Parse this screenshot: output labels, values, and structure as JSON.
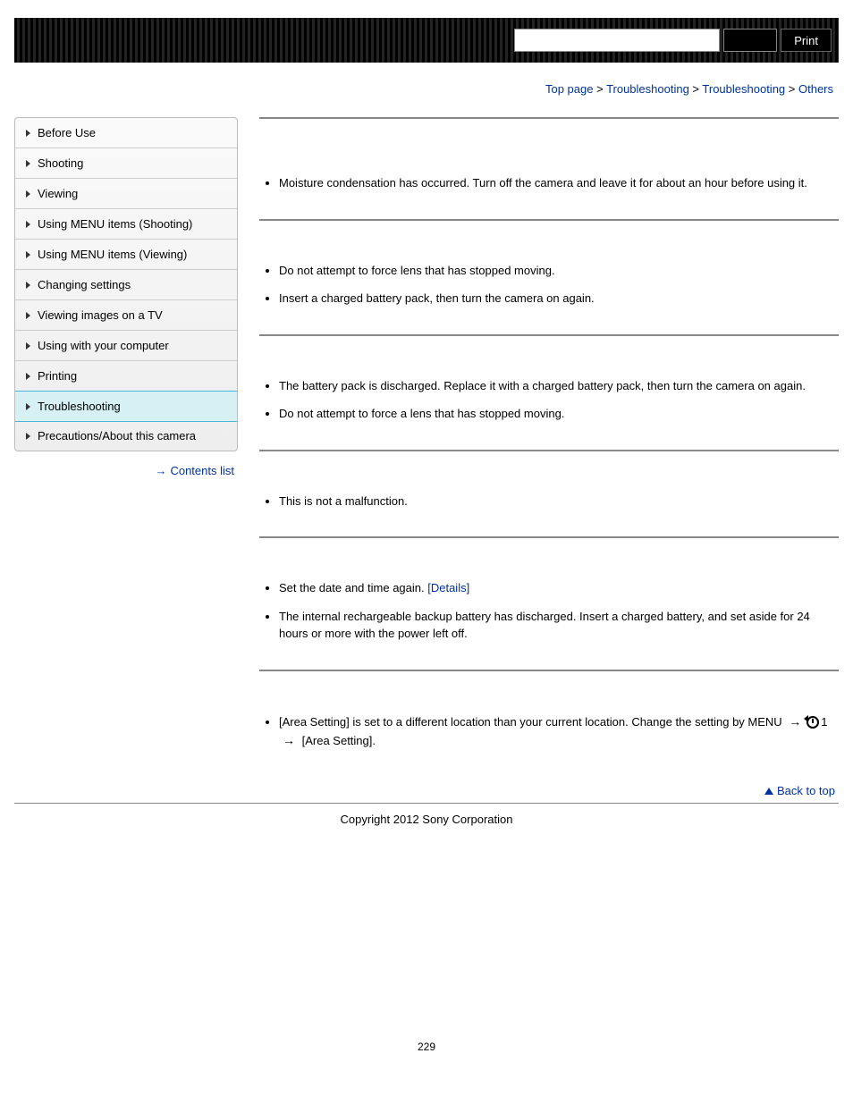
{
  "topbar": {
    "print": "Print"
  },
  "breadcrumb": {
    "items": [
      "Top page",
      "Troubleshooting",
      "Troubleshooting",
      "Others"
    ],
    "sep": " > "
  },
  "sidebar": {
    "items": [
      {
        "label": "Before Use"
      },
      {
        "label": "Shooting"
      },
      {
        "label": "Viewing"
      },
      {
        "label": "Using MENU items (Shooting)"
      },
      {
        "label": "Using MENU items (Viewing)"
      },
      {
        "label": "Changing settings"
      },
      {
        "label": "Viewing images on a TV"
      },
      {
        "label": "Using with your computer"
      },
      {
        "label": "Printing"
      },
      {
        "label": "Troubleshooting",
        "active": true
      },
      {
        "label": "Precautions/About this camera"
      }
    ],
    "contents_prefix": "→",
    "contents": "Contents list"
  },
  "sections": [
    {
      "items": [
        {
          "t": "Moisture condensation has occurred. Turn off the camera and leave it for about an hour before using it."
        }
      ]
    },
    {
      "items": [
        {
          "t": "Do not attempt to force lens that has stopped moving."
        },
        {
          "t": "Insert a charged battery pack, then turn the camera on again."
        }
      ]
    },
    {
      "items": [
        {
          "t": "The battery pack is discharged. Replace it with a charged battery pack, then turn the camera on again."
        },
        {
          "t": "Do not attempt to force a lens that has stopped moving."
        }
      ]
    },
    {
      "items": [
        {
          "t": "This is not a malfunction."
        }
      ]
    },
    {
      "items": [
        {
          "t": "Set the date and time again. ",
          "link": "[Details]"
        },
        {
          "t": "The internal rechargeable backup battery has discharged. Insert a charged battery, and set aside for 24 hours or more with the power left off."
        }
      ]
    },
    {
      "items": [
        {
          "menu_line": true,
          "pre": "[Area Setting] is set to a different location than your current location. Change the setting by MENU ",
          "mid": "1",
          "post": " [Area Setting]."
        }
      ]
    }
  ],
  "backtop": "Back to top",
  "footer": "Copyright 2012 Sony Corporation",
  "pagenum": "229"
}
